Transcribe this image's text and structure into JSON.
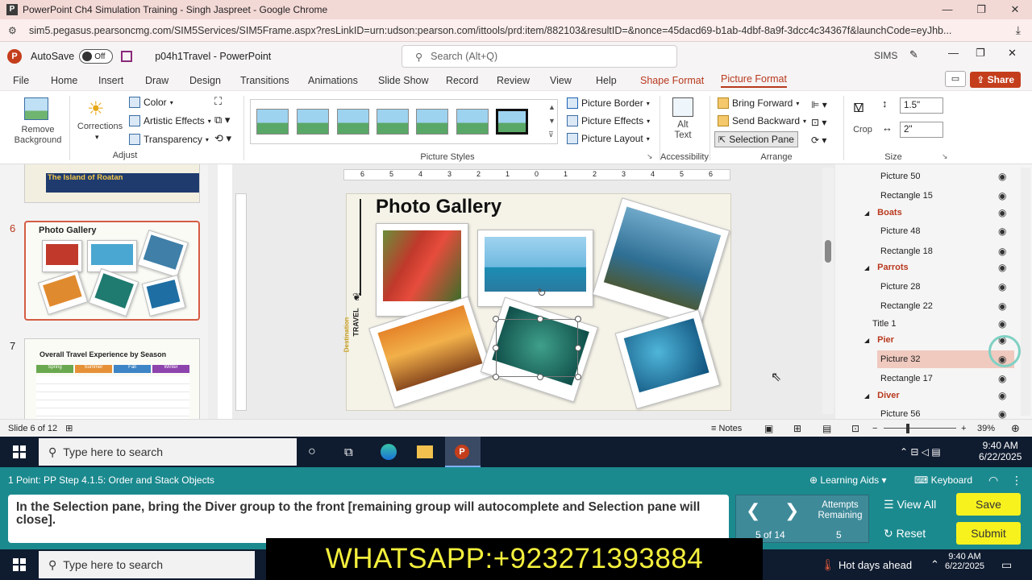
{
  "chrome": {
    "title": "PowerPoint Ch4 Simulation Training - Singh Jaspreet - Google Chrome",
    "url": "sim5.pegasus.pearsoncmg.com/SIM5Services/SIM5Frame.aspx?resLinkID=urn:udson:pearson.com/ittools/prd:item/882103&resultID=&nonce=45dacd69-b1ab-4dbf-8a9f-3dcc4c34367f&launchCode=eyJhb...",
    "minimize": "—",
    "restore": "❐",
    "close": "✕"
  },
  "ppt": {
    "autosave_label": "AutoSave",
    "autosave_state": "Off",
    "filename": "p04h1Travel - PowerPoint",
    "search_placeholder": "Search (Alt+Q)",
    "user": "SIMS",
    "menu": [
      "File",
      "Home",
      "Insert",
      "Draw",
      "Design",
      "Transitions",
      "Animations",
      "Slide Show",
      "Record",
      "Review",
      "View",
      "Help",
      "Shape Format",
      "Picture Format"
    ],
    "share": "Share"
  },
  "ribbon": {
    "remove_bg": [
      "Remove",
      "Background"
    ],
    "corrections": "Corrections",
    "color": "Color",
    "artistic": "Artistic Effects",
    "transparency": "Transparency",
    "adjust": "Adjust",
    "picture_styles": "Picture Styles",
    "picture_border": "Picture Border",
    "picture_effects": "Picture Effects",
    "picture_layout": "Picture Layout",
    "alt_text": [
      "Alt",
      "Text"
    ],
    "accessibility": "Accessibility",
    "bring_forward": "Bring Forward",
    "send_backward": "Send Backward",
    "selection_pane": "Selection Pane",
    "arrange": "Arrange",
    "crop": "Crop",
    "height": "1.5\"",
    "width": "2\"",
    "size": "Size"
  },
  "thumbnails": {
    "slide5_title": "The Island of Roatan",
    "slide6_num": "6",
    "slide6_title": "Photo Gallery",
    "slide7_num": "7",
    "slide7_title": "Overall Travel Experience by Season",
    "slide7_seasons": [
      "Spring",
      "Summer",
      "Fall",
      "Winter"
    ]
  },
  "slide": {
    "title": "Photo Gallery",
    "side_text_1": "Destination",
    "side_text_2": "TRAVEL"
  },
  "ruler_marks": [
    "6",
    "5",
    "4",
    "3",
    "2",
    "1",
    "0",
    "1",
    "2",
    "3",
    "4",
    "5",
    "6"
  ],
  "selection_pane": {
    "rows": [
      {
        "label": "Picture 50",
        "type": "item"
      },
      {
        "label": "Rectangle 15",
        "type": "item"
      },
      {
        "label": "Boats",
        "type": "group"
      },
      {
        "label": "Picture 48",
        "type": "item"
      },
      {
        "label": "Rectangle 18",
        "type": "item"
      },
      {
        "label": "Parrots",
        "type": "group"
      },
      {
        "label": "Picture 28",
        "type": "item"
      },
      {
        "label": "Rectangle 22",
        "type": "item"
      },
      {
        "label": "Title 1",
        "type": "top"
      },
      {
        "label": "Pier",
        "type": "group"
      },
      {
        "label": "Picture 32",
        "type": "selected"
      },
      {
        "label": "Rectangle 17",
        "type": "item"
      },
      {
        "label": "Diver",
        "type": "group"
      },
      {
        "label": "Picture 56",
        "type": "item"
      }
    ]
  },
  "status": {
    "slide_info": "Slide 6 of 12",
    "notes": "Notes",
    "zoom": "39%"
  },
  "taskbar": {
    "search_placeholder": "Type here to search",
    "time": "9:40 AM",
    "date": "6/22/2025",
    "weather": "Hot days ahead"
  },
  "instructions": {
    "step": "1 Point: PP Step 4.1.5: Order and Stack Objects",
    "learning_aids": "Learning Aids",
    "keyboard": "Keyboard",
    "task": "In the Selection pane, bring the Diver group to the front [remaining group will autocomplete and Selection pane will close].",
    "progress": "5 of 14",
    "attempts_label": [
      "Attempts",
      "Remaining"
    ],
    "attempts": "5",
    "view_all": "View All",
    "reset": "Reset",
    "save": "Save",
    "submit": "Submit"
  },
  "overlay": "WHATSAPP:+923271393884"
}
